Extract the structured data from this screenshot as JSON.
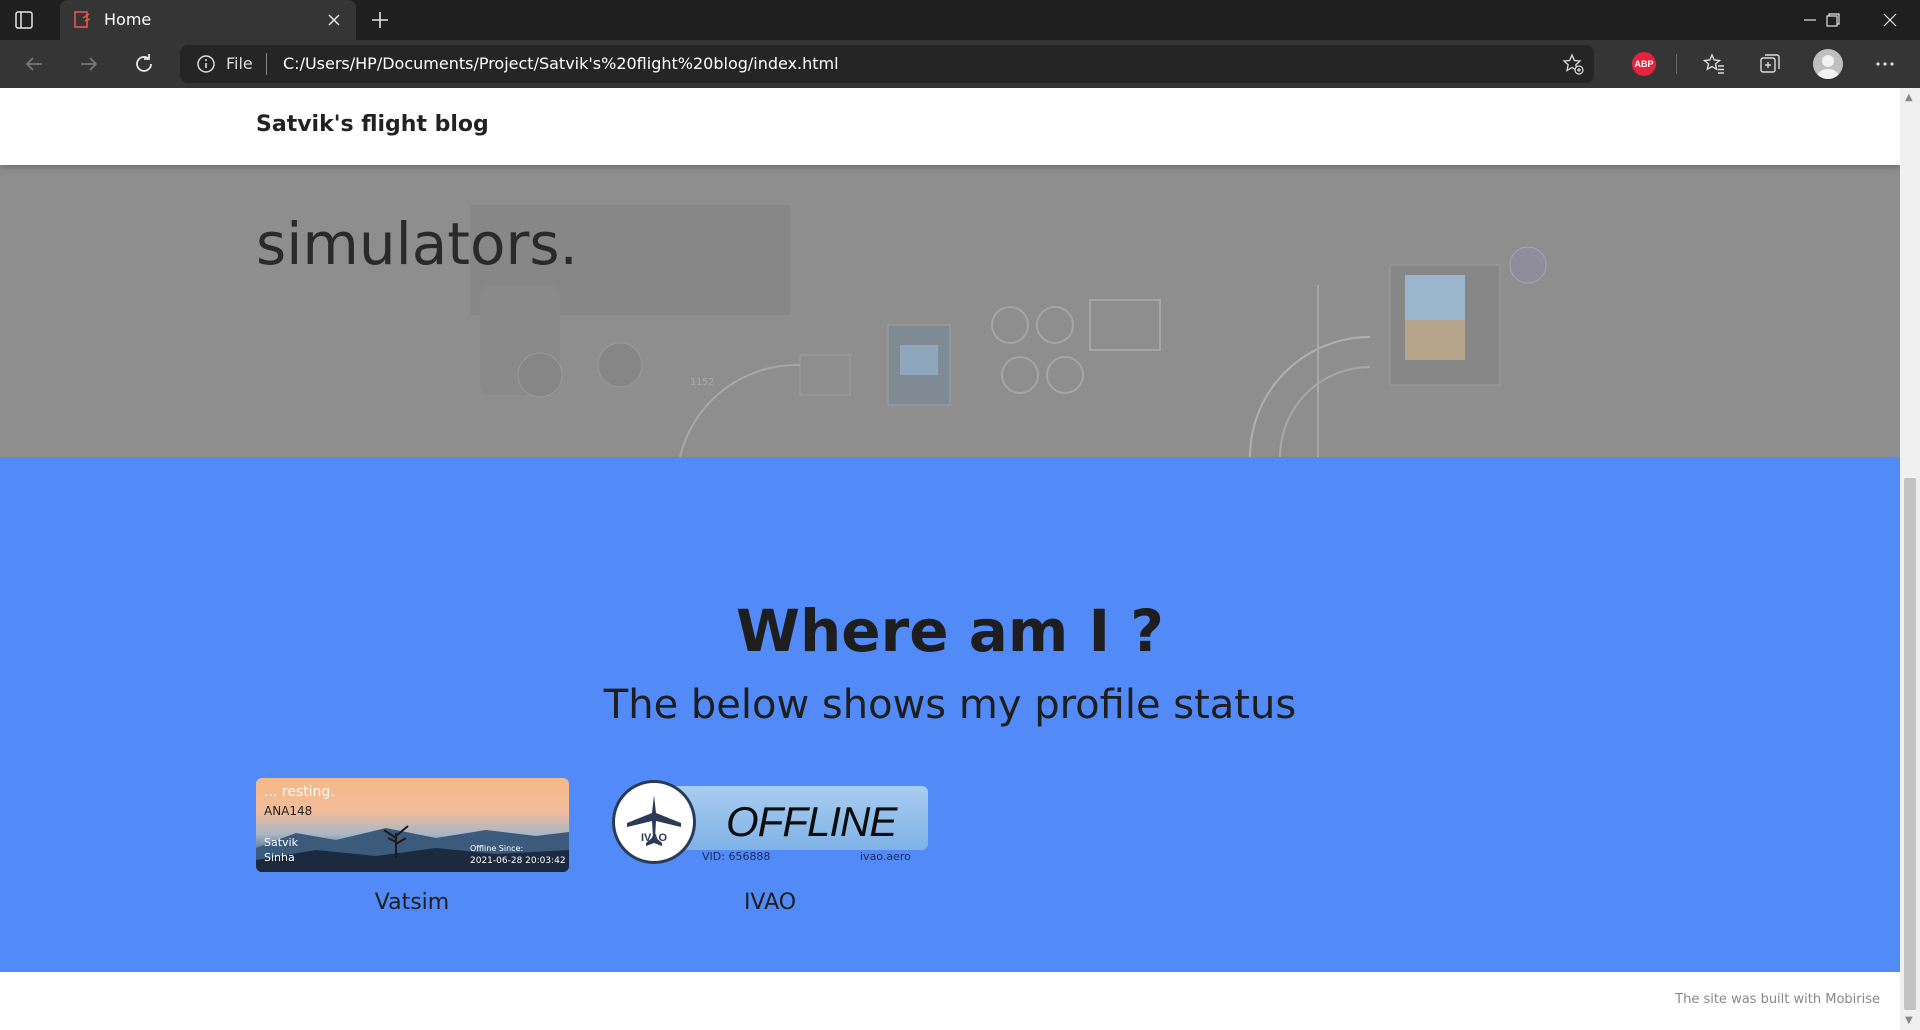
{
  "browser": {
    "tab_title": "Home",
    "address_prefix": "File",
    "url": "C:/Users/HP/Documents/Project/Satvik's%20flight%20blog/index.html",
    "abp_label": "ABP"
  },
  "site": {
    "brand": "Satvik's flight blog",
    "hero_text": "simulators."
  },
  "status_section": {
    "title": "Where am I ?",
    "subtitle": "The below shows my profile status",
    "background": "#528af7"
  },
  "vatsim": {
    "status": "... resting.",
    "callsign": "ANA148",
    "first_name": "Satvik",
    "last_name": "Sinha",
    "since_label": "Offline Since:",
    "since": "2021-06-28 20:03:42",
    "label": "Vatsim"
  },
  "ivao": {
    "logo_text": "IVAO",
    "status": "OFFLINE",
    "vid": "VID: 656888",
    "website": "ivao.aero",
    "label": "IVAO"
  },
  "footer": {
    "built_with": "The site was built with Mobirise"
  }
}
